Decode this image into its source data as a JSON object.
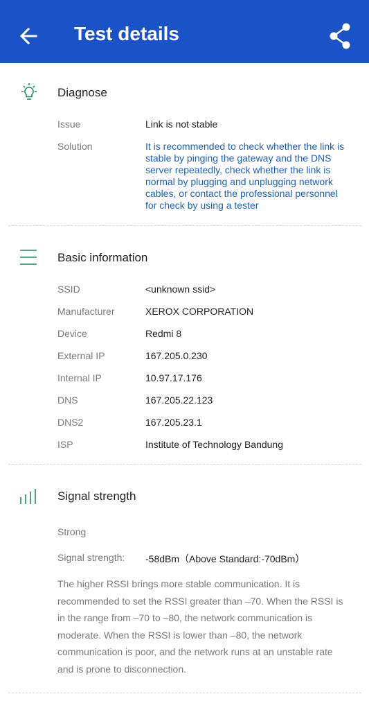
{
  "header": {
    "title": "Test details",
    "back_icon": "arrow-left-icon",
    "share_icon": "share-icon",
    "color": "#1a52c7"
  },
  "diagnose": {
    "title": "Diagnose",
    "icon": "lightbulb-icon",
    "issue_label": "Issue",
    "issue_value": "Link is not stable",
    "solution_label": "Solution",
    "solution_value": "It is recommended to check whether the link is stable by pinging the gateway and the DNS server repeatedly, check whether the link is normal by plugging and unplugging network cables, or contact the professional personnel for check by using a tester"
  },
  "basic": {
    "title": "Basic information",
    "icon": "list-icon",
    "rows": [
      {
        "label": "SSID",
        "value": "<unknown ssid>"
      },
      {
        "label": "Manufacturer",
        "value": "XEROX CORPORATION"
      },
      {
        "label": "Device",
        "value": "Redmi 8"
      },
      {
        "label": "External IP",
        "value": "167.205.0.230"
      },
      {
        "label": "Internal IP",
        "value": "10.97.17.176"
      },
      {
        "label": "DNS",
        "value": "167.205.22.123"
      },
      {
        "label": "DNS2",
        "value": "167.205.23.1"
      },
      {
        "label": "ISP",
        "value": "Institute of Technology Bandung"
      }
    ]
  },
  "signal": {
    "title": "Signal strength",
    "icon": "signal-bars-icon",
    "status": "Strong",
    "strength_label": "Signal strength:",
    "strength_value": "-58dBm（Above Standard:-70dBm）",
    "description": "The higher RSSI brings more stable communication. It is recommended to set the RSSI greater than –70. When the RSSI is in the range from –70 to –80, the network communication is moderate. When the RSSI is lower than –80, the network communication is poor, and the network runs at an unstable rate and is prone to disconnection."
  },
  "accent_color": "#1e8a5a"
}
